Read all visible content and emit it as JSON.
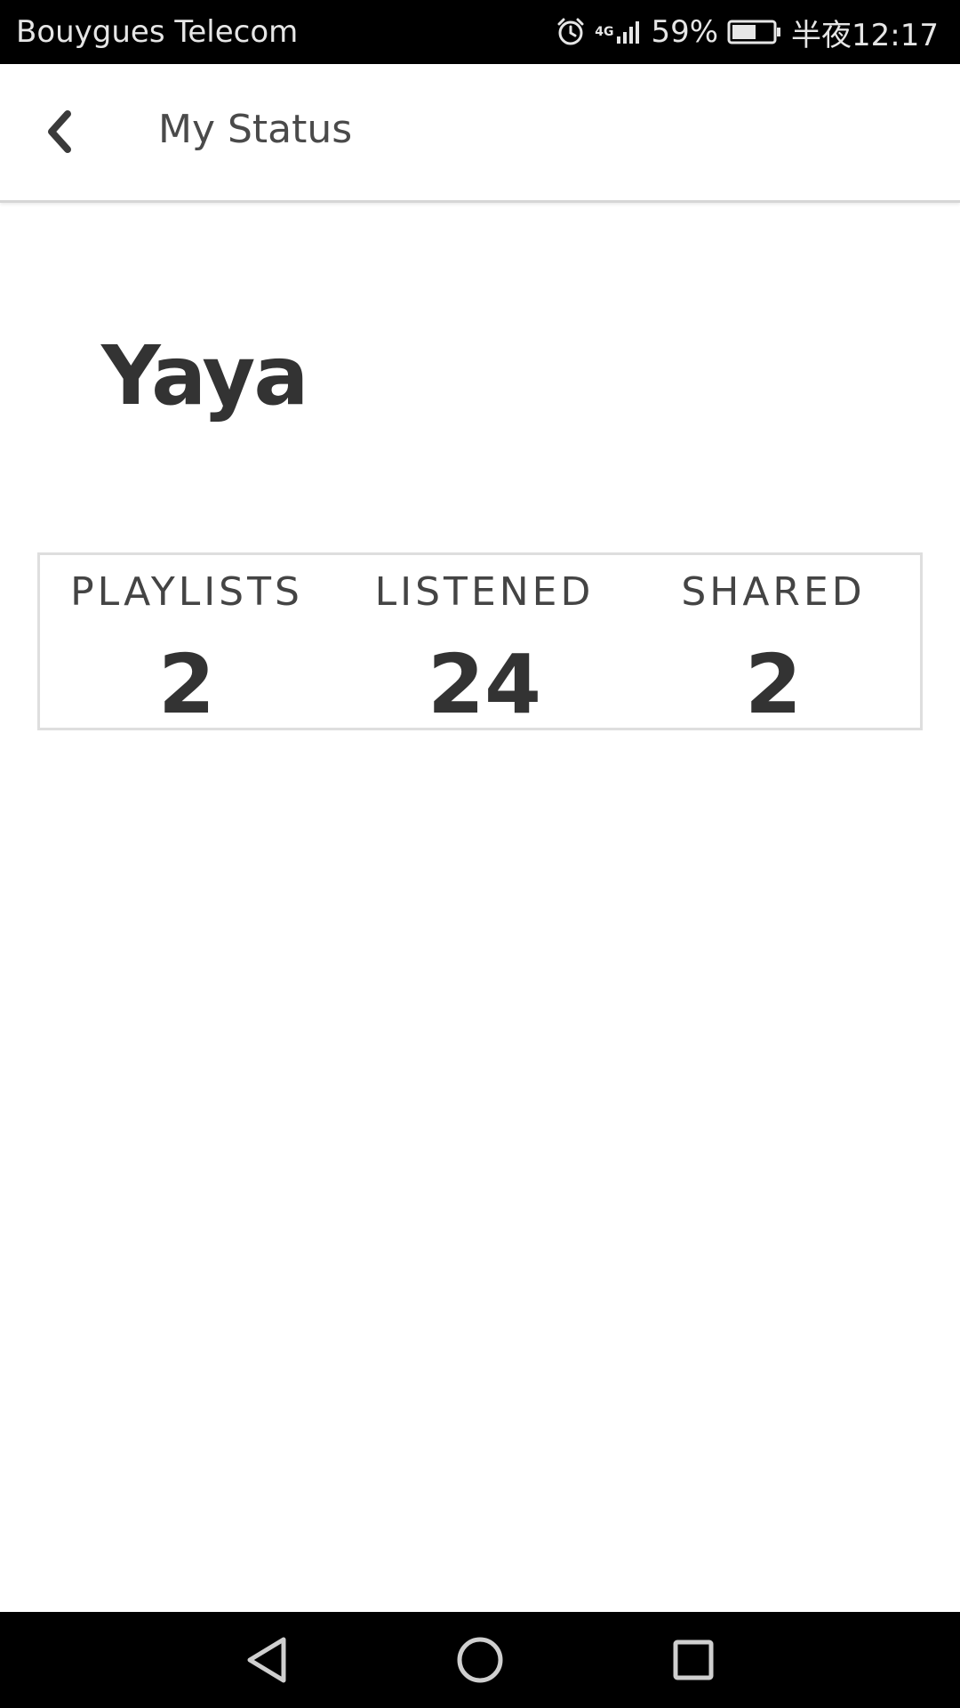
{
  "status_bar": {
    "carrier": "Bouygues Telecom",
    "alarm_icon": "alarm-clock-icon",
    "network_label": "4G",
    "signal_icon": "signal-strength-icon",
    "battery_percent": "59%",
    "battery_level": 0.59,
    "time": "半夜12:17"
  },
  "app_bar": {
    "back_icon": "chevron-left-icon",
    "title": "My Status"
  },
  "profile": {
    "name": "Yaya"
  },
  "stats": [
    {
      "label": "PLAYLISTS",
      "value": "2"
    },
    {
      "label": "LISTENED",
      "value": "24"
    },
    {
      "label": "SHARED",
      "value": "2"
    }
  ],
  "nav_bar": {
    "back_icon": "triangle-back-icon",
    "home_icon": "circle-home-icon",
    "recent_icon": "square-recents-icon"
  },
  "colors": {
    "status_bar_bg": "#000000",
    "text_primary": "#333333",
    "divider": "#dedede"
  }
}
